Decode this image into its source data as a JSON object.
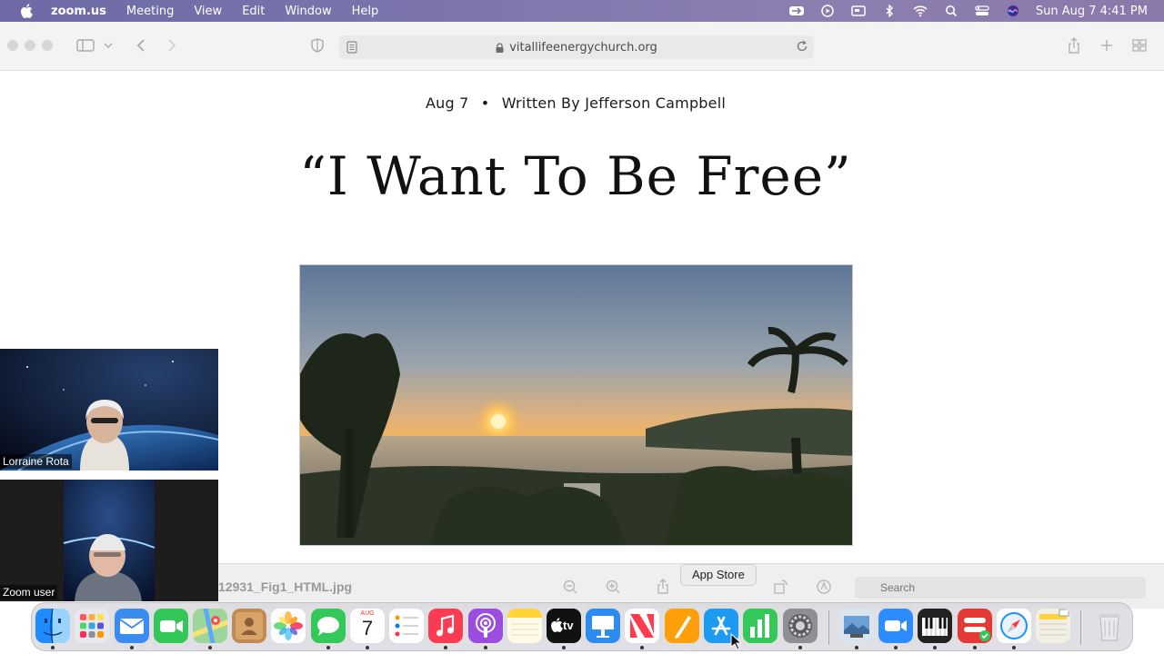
{
  "menubar": {
    "apple_icon": "apple-icon",
    "app_name": "zoom.us",
    "menus": [
      "Meeting",
      "View",
      "Edit",
      "Window",
      "Help"
    ],
    "status_icons": [
      "zoom-share-icon",
      "play-circle-icon",
      "screen-icon",
      "bluetooth-icon",
      "wifi-icon",
      "search-icon",
      "control-center-icon",
      "siri-icon"
    ],
    "clock": "Sun Aug 7  4:41 PM"
  },
  "browser": {
    "url": "vitallifeenergychurch.org"
  },
  "post": {
    "date": "Aug 7",
    "separator": "•",
    "byline": "Written By Jefferson Campbell",
    "title": "“I Want To Be Free”"
  },
  "zoom": {
    "participants": [
      {
        "name": "Lorraine Rota"
      },
      {
        "name": "Zoom user"
      }
    ]
  },
  "preview": {
    "filename": "12931_Fig1_HTML.jpg",
    "search_placeholder": "Search"
  },
  "tooltip": "App Store",
  "dock": {
    "calendar_month": "AUG",
    "calendar_day": "7",
    "tv_label": "tv",
    "apps": [
      "Finder",
      "Launchpad",
      "Mail",
      "FaceTime",
      "Maps",
      "Contacts",
      "Photos",
      "Messages",
      "Calendar",
      "Reminders",
      "Music",
      "Podcasts",
      "Notes",
      "TV",
      "Keynote",
      "News",
      "Pages",
      "App Store",
      "Numbers",
      "System Preferences",
      "Preview",
      "Zoom",
      "Piano",
      "Remote Desktop",
      "Safari",
      "Notes Stack",
      "Trash"
    ]
  }
}
